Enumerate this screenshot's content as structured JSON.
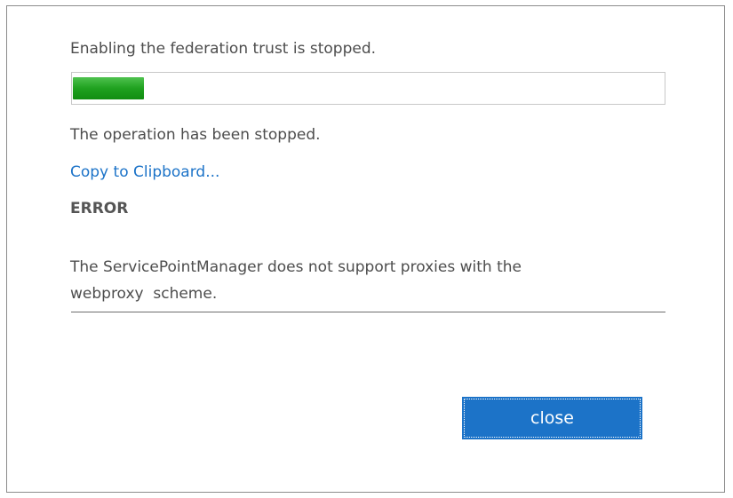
{
  "dialog": {
    "status_text": "Enabling the federation trust is stopped.",
    "progress": {
      "fraction": 0.12,
      "color": "#1fa11f"
    },
    "operation_text": "The operation has been stopped.",
    "copy_link_label": "Copy to Clipboard...",
    "error_heading": "ERROR",
    "error_message": "The ServicePointManager does not support proxies with the\nwebproxy  scheme.",
    "close_label": "close"
  },
  "colors": {
    "accent": "#1c73c8",
    "text": "#4d4d4d"
  }
}
